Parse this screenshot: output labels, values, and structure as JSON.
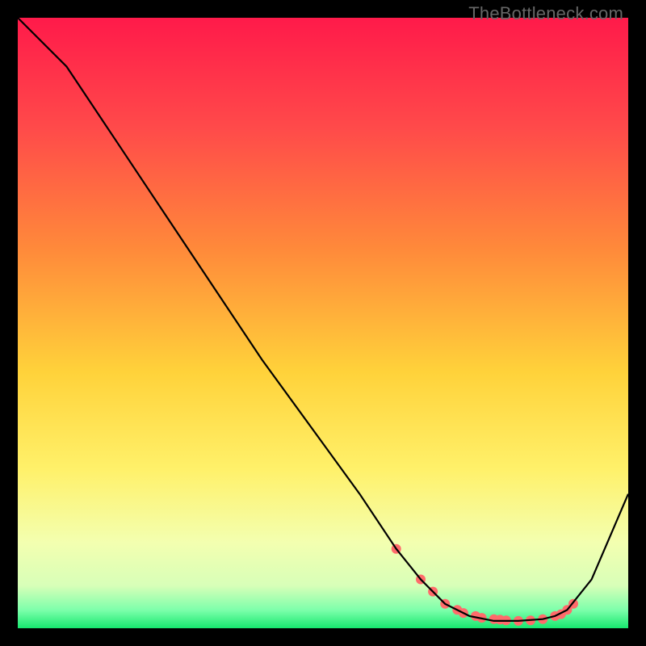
{
  "watermark": "TheBottleneck.com",
  "colors": {
    "grad_top": "#ff1a4a",
    "grad_mid1": "#ff7a3a",
    "grad_mid2": "#ffe23a",
    "grad_low": "#f6ff9a",
    "grad_band": "#e6ffb0",
    "grad_green": "#17e86f",
    "line": "#000000",
    "dot": "#ff6b6b"
  },
  "chart_data": {
    "type": "line",
    "title": "",
    "xlabel": "",
    "ylabel": "",
    "xlim": [
      0,
      100
    ],
    "ylim": [
      0,
      100
    ],
    "series": [
      {
        "name": "curve",
        "x": [
          0,
          8,
          16,
          24,
          32,
          40,
          48,
          56,
          62,
          66,
          70,
          74,
          78,
          82,
          86,
          88,
          90,
          94,
          100
        ],
        "y": [
          100,
          92,
          80,
          68,
          56,
          44,
          33,
          22,
          13,
          8,
          4,
          2,
          1.2,
          1.2,
          1.5,
          2,
          3,
          8,
          22
        ]
      }
    ],
    "markers": {
      "name": "dots",
      "x": [
        62,
        66,
        68,
        70,
        72,
        73,
        75,
        76,
        78,
        79,
        80,
        82,
        84,
        86,
        88,
        89,
        90,
        91
      ],
      "y": [
        13,
        8,
        6,
        4,
        3,
        2.5,
        2,
        1.7,
        1.5,
        1.4,
        1.3,
        1.2,
        1.3,
        1.5,
        2,
        2.3,
        3,
        4
      ]
    }
  }
}
